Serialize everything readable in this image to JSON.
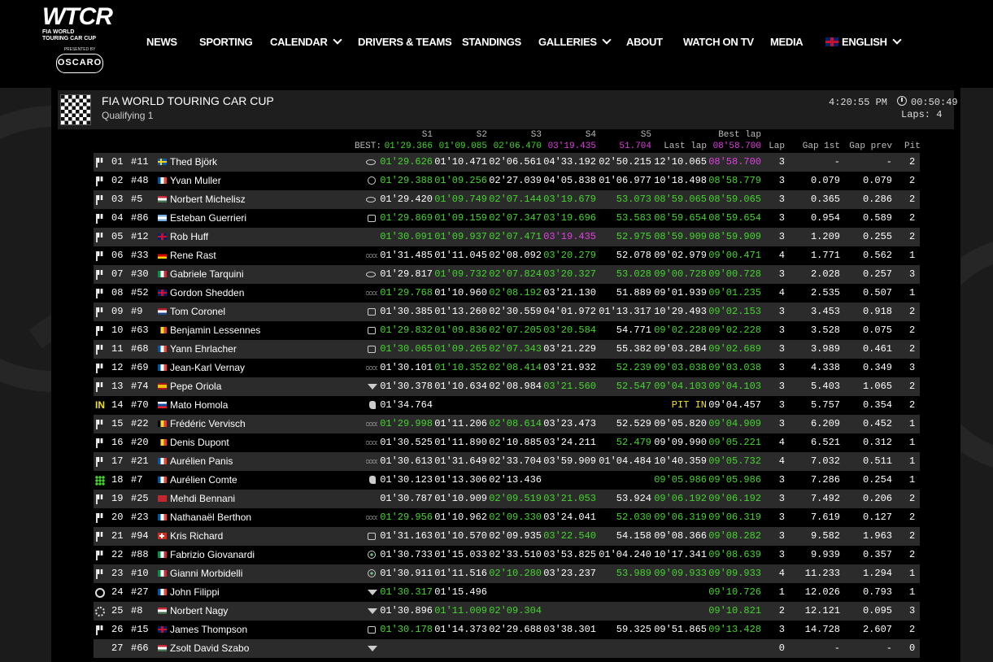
{
  "nav": {
    "logo": {
      "wordmark": "WTCR",
      "line1": "FIA WORLD",
      "line2": "TOURING CAR CUP",
      "presented": "PRESENTED BY",
      "sponsor": "OSCARO"
    },
    "items": [
      {
        "label": "NEWS",
        "dropdown": false
      },
      {
        "label": "SPORTING",
        "dropdown": false
      },
      {
        "label": "CALENDAR",
        "dropdown": true
      },
      {
        "label": "DRIVERS & TEAMS",
        "dropdown": false
      },
      {
        "label": "STANDINGS",
        "dropdown": false
      },
      {
        "label": "GALLERIES",
        "dropdown": true
      },
      {
        "label": "ABOUT",
        "dropdown": false
      },
      {
        "label": "WATCH ON TV",
        "dropdown": false
      },
      {
        "label": "MEDIA",
        "dropdown": false
      }
    ],
    "language": "ENGLISH"
  },
  "session": {
    "series": "FIA WORLD TOURING CAR CUP",
    "name": "Qualifying 1",
    "clock": "4:20:55 PM",
    "remaining": "00:50:49",
    "laps": "Laps: 4"
  },
  "columns": {
    "best_label": "BEST:",
    "s1": "S1",
    "s2": "S2",
    "s3": "S3",
    "s4": "S4",
    "s5": "S5",
    "last_lap": "Last lap",
    "best_lap": "Best lap",
    "lap": "Lap",
    "gap_1st": "Gap 1st",
    "gap_prev": "Gap prev",
    "pit": "Pit"
  },
  "best": {
    "s1": "01'29.366",
    "s2": "01'09.085",
    "s3": "02'06.470",
    "s4": "03'19.435",
    "s5": "51.704",
    "best_lap": "08'58.700"
  },
  "colors": {
    "green": "#44d62c",
    "purple": "#e040e0",
    "yellow": "#f0e020"
  },
  "rows": [
    {
      "status": "flag",
      "pos": "01",
      "num": "#11",
      "flag": "se",
      "driver": "Thed Björk",
      "brand": "hyundai",
      "s1": "01'29.626",
      "s1c": "g",
      "s2": "01'10.471",
      "s2c": "w",
      "s3": "02'06.561",
      "s3c": "w",
      "s4": "04'33.192",
      "s4c": "w",
      "s5": "02'50.215",
      "s5c": "w",
      "last": "12'10.065",
      "lastc": "w",
      "best": "08'58.700",
      "bestc": "p",
      "lap": "3",
      "gap1": "-",
      "gapp": "-",
      "pit": "2"
    },
    {
      "status": "flag",
      "pos": "02",
      "num": "#48",
      "flag": "fr",
      "driver": "Yvan Muller",
      "brand": "lynk",
      "s1": "01'29.388",
      "s1c": "g",
      "s2": "01'09.256",
      "s2c": "g",
      "s3": "02'27.039",
      "s3c": "w",
      "s4": "04'05.838",
      "s4c": "w",
      "s5": "01'06.977",
      "s5c": "w",
      "last": "10'18.498",
      "lastc": "w",
      "best": "08'58.779",
      "bestc": "g",
      "lap": "3",
      "gap1": "0.079",
      "gapp": "0.079",
      "pit": "2"
    },
    {
      "status": "flag",
      "pos": "03",
      "num": "#5",
      "flag": "hu",
      "driver": "Norbert Michelisz",
      "brand": "hyundai",
      "s1": "01'29.420",
      "s1c": "w",
      "s2": "01'09.749",
      "s2c": "g",
      "s3": "02'07.144",
      "s3c": "g",
      "s4": "03'19.679",
      "s4c": "g",
      "s5": "53.073",
      "s5c": "g",
      "last": "08'59.065",
      "lastc": "g",
      "best": "08'59.065",
      "bestc": "g",
      "lap": "3",
      "gap1": "0.365",
      "gapp": "0.286",
      "pit": "2"
    },
    {
      "status": "flag",
      "pos": "04",
      "num": "#86",
      "flag": "ar",
      "driver": "Esteban Guerrieri",
      "brand": "honda",
      "s1": "01'29.869",
      "s1c": "g",
      "s2": "01'09.159",
      "s2c": "g",
      "s3": "02'07.347",
      "s3c": "g",
      "s4": "03'19.696",
      "s4c": "g",
      "s5": "53.583",
      "s5c": "g",
      "last": "08'59.654",
      "lastc": "g",
      "best": "08'59.654",
      "bestc": "g",
      "lap": "3",
      "gap1": "0.954",
      "gapp": "0.589",
      "pit": "2"
    },
    {
      "status": "flag",
      "pos": "05",
      "num": "#12",
      "flag": "gb",
      "driver": "Rob Huff",
      "brand": "vw",
      "s1": "01'30.091",
      "s1c": "g",
      "s2": "01'09.937",
      "s2c": "g",
      "s3": "02'07.471",
      "s3c": "g",
      "s4": "03'19.435",
      "s4c": "p",
      "s5": "52.975",
      "s5c": "g",
      "last": "08'59.909",
      "lastc": "g",
      "best": "08'59.909",
      "bestc": "g",
      "lap": "3",
      "gap1": "1.209",
      "gapp": "0.255",
      "pit": "2"
    },
    {
      "status": "flag",
      "pos": "06",
      "num": "#33",
      "flag": "de",
      "driver": "Rene Rast",
      "brand": "audi",
      "s1": "01'31.485",
      "s1c": "w",
      "s2": "01'11.045",
      "s2c": "w",
      "s3": "02'08.092",
      "s3c": "w",
      "s4": "03'20.279",
      "s4c": "g",
      "s5": "52.078",
      "s5c": "w",
      "last": "09'02.979",
      "lastc": "w",
      "best": "09'00.471",
      "bestc": "g",
      "lap": "4",
      "gap1": "1.771",
      "gapp": "0.562",
      "pit": "1"
    },
    {
      "status": "flag",
      "pos": "07",
      "num": "#30",
      "flag": "it",
      "driver": "Gabriele Tarquini",
      "brand": "hyundai",
      "s1": "01'29.817",
      "s1c": "w",
      "s2": "01'09.732",
      "s2c": "g",
      "s3": "02'07.824",
      "s3c": "g",
      "s4": "03'20.327",
      "s4c": "g",
      "s5": "53.028",
      "s5c": "g",
      "last": "09'00.728",
      "lastc": "g",
      "best": "09'00.728",
      "bestc": "g",
      "lap": "3",
      "gap1": "2.028",
      "gapp": "0.257",
      "pit": "3"
    },
    {
      "status": "flag",
      "pos": "08",
      "num": "#52",
      "flag": "gb",
      "driver": "Gordon Shedden",
      "brand": "audi",
      "s1": "01'29.768",
      "s1c": "g",
      "s2": "01'10.960",
      "s2c": "w",
      "s3": "02'08.192",
      "s3c": "g",
      "s4": "03'21.130",
      "s4c": "w",
      "s5": "51.889",
      "s5c": "w",
      "last": "09'01.939",
      "lastc": "w",
      "best": "09'01.235",
      "bestc": "g",
      "lap": "4",
      "gap1": "2.535",
      "gapp": "0.507",
      "pit": "1"
    },
    {
      "status": "flag",
      "pos": "09",
      "num": "#9",
      "flag": "nl",
      "driver": "Tom Coronel",
      "brand": "honda",
      "s1": "01'30.385",
      "s1c": "w",
      "s2": "01'13.260",
      "s2c": "w",
      "s3": "02'30.559",
      "s3c": "w",
      "s4": "04'01.972",
      "s4c": "w",
      "s5": "01'13.317",
      "s5c": "w",
      "last": "10'29.493",
      "lastc": "w",
      "best": "09'02.153",
      "bestc": "g",
      "lap": "3",
      "gap1": "3.453",
      "gapp": "0.918",
      "pit": "2"
    },
    {
      "status": "flag",
      "pos": "10",
      "num": "#63",
      "flag": "be",
      "driver": "Benjamin Lessennes",
      "brand": "honda",
      "s1": "01'29.832",
      "s1c": "g",
      "s2": "01'09.836",
      "s2c": "g",
      "s3": "02'07.205",
      "s3c": "g",
      "s4": "03'20.584",
      "s4c": "g",
      "s5": "54.771",
      "s5c": "w",
      "last": "09'02.228",
      "lastc": "g",
      "best": "09'02.228",
      "bestc": "g",
      "lap": "3",
      "gap1": "3.528",
      "gapp": "0.075",
      "pit": "2"
    },
    {
      "status": "flag",
      "pos": "11",
      "num": "#68",
      "flag": "fr",
      "driver": "Yann Ehrlacher",
      "brand": "honda",
      "s1": "01'30.065",
      "s1c": "g",
      "s2": "01'09.265",
      "s2c": "g",
      "s3": "02'07.343",
      "s3c": "g",
      "s4": "03'21.229",
      "s4c": "w",
      "s5": "55.382",
      "s5c": "w",
      "last": "09'03.284",
      "lastc": "w",
      "best": "09'02.689",
      "bestc": "g",
      "lap": "3",
      "gap1": "3.989",
      "gapp": "0.461",
      "pit": "2"
    },
    {
      "status": "flag",
      "pos": "12",
      "num": "#69",
      "flag": "fr",
      "driver": "Jean-Karl Vernay",
      "brand": "audi",
      "s1": "01'30.101",
      "s1c": "w",
      "s2": "01'10.352",
      "s2c": "g",
      "s3": "02'08.414",
      "s3c": "g",
      "s4": "03'21.932",
      "s4c": "w",
      "s5": "52.239",
      "s5c": "g",
      "last": "09'03.038",
      "lastc": "g",
      "best": "09'03.038",
      "bestc": "g",
      "lap": "3",
      "gap1": "4.338",
      "gapp": "0.349",
      "pit": "3"
    },
    {
      "status": "flag",
      "pos": "13",
      "num": "#74",
      "flag": "es",
      "driver": "Pepe Oriola",
      "brand": "cupra",
      "s1": "01'30.378",
      "s1c": "w",
      "s2": "01'10.634",
      "s2c": "w",
      "s3": "02'08.984",
      "s3c": "w",
      "s4": "03'21.560",
      "s4c": "g",
      "s5": "52.547",
      "s5c": "g",
      "last": "09'04.103",
      "lastc": "g",
      "best": "09'04.103",
      "bestc": "g",
      "lap": "3",
      "gap1": "5.403",
      "gapp": "1.065",
      "pit": "2"
    },
    {
      "status": "in",
      "pos": "14",
      "num": "#70",
      "flag": "sk",
      "driver": "Mato Homola",
      "brand": "peugeot",
      "s1": "01'34.764",
      "s1c": "w",
      "s2": "",
      "s2c": "w",
      "s3": "",
      "s3c": "w",
      "s4": "",
      "s4c": "w",
      "s5": "",
      "s5c": "w",
      "last": "PIT IN",
      "lastc": "y",
      "best": "09'04.457",
      "bestc": "w",
      "lap": "3",
      "gap1": "5.757",
      "gapp": "0.354",
      "pit": "2"
    },
    {
      "status": "flag",
      "pos": "15",
      "num": "#22",
      "flag": "be",
      "driver": "Frédéric Vervisch",
      "brand": "audi",
      "s1": "01'29.998",
      "s1c": "g",
      "s2": "01'11.206",
      "s2c": "w",
      "s3": "02'08.614",
      "s3c": "g",
      "s4": "03'23.473",
      "s4c": "w",
      "s5": "52.529",
      "s5c": "w",
      "last": "09'05.820",
      "lastc": "w",
      "best": "09'04.909",
      "bestc": "g",
      "lap": "3",
      "gap1": "6.209",
      "gapp": "0.452",
      "pit": "1"
    },
    {
      "status": "flag",
      "pos": "16",
      "num": "#20",
      "flag": "be",
      "driver": "Denis Dupont",
      "brand": "audi",
      "s1": "01'30.525",
      "s1c": "w",
      "s2": "01'11.890",
      "s2c": "w",
      "s3": "02'10.885",
      "s3c": "w",
      "s4": "03'24.211",
      "s4c": "w",
      "s5": "52.479",
      "s5c": "g",
      "last": "09'09.990",
      "lastc": "w",
      "best": "09'05.221",
      "bestc": "g",
      "lap": "4",
      "gap1": "6.521",
      "gapp": "0.312",
      "pit": "1"
    },
    {
      "status": "flag",
      "pos": "17",
      "num": "#21",
      "flag": "fr",
      "driver": "Aurélien Panis",
      "brand": "audi",
      "s1": "01'30.613",
      "s1c": "w",
      "s2": "01'31.649",
      "s2c": "w",
      "s3": "02'33.704",
      "s3c": "w",
      "s4": "03'59.909",
      "s4c": "w",
      "s5": "01'04.484",
      "s5c": "w",
      "last": "10'40.359",
      "lastc": "w",
      "best": "09'05.732",
      "bestc": "g",
      "lap": "4",
      "gap1": "7.032",
      "gapp": "0.511",
      "pit": "1"
    },
    {
      "status": "dots",
      "pos": "18",
      "num": "#7",
      "flag": "fr",
      "driver": "Aurélien Comte",
      "brand": "peugeot",
      "s1": "01'30.123",
      "s1c": "w",
      "s2": "01'13.306",
      "s2c": "w",
      "s3": "02'13.436",
      "s3c": "w",
      "s4": "",
      "s4c": "w",
      "s5": "",
      "s5c": "w",
      "last": "09'05.986",
      "lastc": "g",
      "best": "09'05.986",
      "bestc": "g",
      "lap": "3",
      "gap1": "7.286",
      "gapp": "0.254",
      "pit": "1"
    },
    {
      "status": "flag",
      "pos": "19",
      "num": "#25",
      "flag": "ma",
      "driver": "Mehdi Bennani",
      "brand": "vw",
      "s1": "01'30.787",
      "s1c": "w",
      "s2": "01'10.909",
      "s2c": "w",
      "s3": "02'09.519",
      "s3c": "g",
      "s4": "03'21.053",
      "s4c": "g",
      "s5": "53.924",
      "s5c": "w",
      "last": "09'06.192",
      "lastc": "g",
      "best": "09'06.192",
      "bestc": "g",
      "lap": "3",
      "gap1": "7.492",
      "gapp": "0.206",
      "pit": "2"
    },
    {
      "status": "flag",
      "pos": "20",
      "num": "#23",
      "flag": "fr",
      "driver": "Nathanaël Berthon",
      "brand": "audi",
      "s1": "01'29.956",
      "s1c": "g",
      "s2": "01'10.962",
      "s2c": "w",
      "s3": "02'09.330",
      "s3c": "g",
      "s4": "03'24.041",
      "s4c": "w",
      "s5": "52.030",
      "s5c": "g",
      "last": "09'06.319",
      "lastc": "g",
      "best": "09'06.319",
      "bestc": "g",
      "lap": "3",
      "gap1": "7.619",
      "gapp": "0.127",
      "pit": "2"
    },
    {
      "status": "flag",
      "pos": "21",
      "num": "#94",
      "flag": "ch",
      "driver": "Kris Richard",
      "brand": "honda",
      "s1": "01'31.163",
      "s1c": "w",
      "s2": "01'10.570",
      "s2c": "w",
      "s3": "02'09.935",
      "s3c": "w",
      "s4": "03'22.540",
      "s4c": "g",
      "s5": "54.158",
      "s5c": "w",
      "last": "09'08.366",
      "lastc": "w",
      "best": "09'08.282",
      "bestc": "g",
      "lap": "3",
      "gap1": "9.582",
      "gapp": "1.963",
      "pit": "2"
    },
    {
      "status": "flag",
      "pos": "22",
      "num": "#88",
      "flag": "it",
      "driver": "Fabrizio Giovanardi",
      "brand": "alfa",
      "s1": "01'30.733",
      "s1c": "w",
      "s2": "01'15.033",
      "s2c": "w",
      "s3": "02'33.510",
      "s3c": "w",
      "s4": "03'53.825",
      "s4c": "w",
      "s5": "01'04.240",
      "s5c": "w",
      "last": "10'17.341",
      "lastc": "w",
      "best": "09'08.639",
      "bestc": "g",
      "lap": "3",
      "gap1": "9.939",
      "gapp": "0.357",
      "pit": "2"
    },
    {
      "status": "flag",
      "pos": "23",
      "num": "#10",
      "flag": "it",
      "driver": "Gianni Morbidelli",
      "brand": "alfa",
      "s1": "01'30.911",
      "s1c": "w",
      "s2": "01'11.516",
      "s2c": "w",
      "s3": "02'10.280",
      "s3c": "g",
      "s4": "03'23.237",
      "s4c": "w",
      "s5": "53.989",
      "s5c": "g",
      "last": "09'09.933",
      "lastc": "g",
      "best": "09'09.933",
      "bestc": "g",
      "lap": "4",
      "gap1": "11.233",
      "gapp": "1.294",
      "pit": "1"
    },
    {
      "status": "ring",
      "pos": "24",
      "num": "#27",
      "flag": "fr",
      "driver": "John Filippi",
      "brand": "cupra",
      "s1": "01'30.317",
      "s1c": "g",
      "s2": "01'15.496",
      "s2c": "w",
      "s3": "",
      "s3c": "w",
      "s4": "",
      "s4c": "w",
      "s5": "",
      "s5c": "w",
      "last": "",
      "lastc": "w",
      "best": "09'10.726",
      "bestc": "g",
      "lap": "1",
      "gap1": "12.026",
      "gapp": "0.793",
      "pit": "1"
    },
    {
      "status": "dashring",
      "pos": "25",
      "num": "#8",
      "flag": "hu",
      "driver": "Norbert Nagy",
      "brand": "cupra",
      "s1": "01'30.896",
      "s1c": "w",
      "s2": "01'11.009",
      "s2c": "g",
      "s3": "02'09.304",
      "s3c": "g",
      "s4": "",
      "s4c": "w",
      "s5": "",
      "s5c": "w",
      "last": "",
      "lastc": "w",
      "best": "09'10.821",
      "bestc": "g",
      "lap": "2",
      "gap1": "12.121",
      "gapp": "0.095",
      "pit": "3"
    },
    {
      "status": "flag",
      "pos": "26",
      "num": "#15",
      "flag": "gb",
      "driver": "James Thompson",
      "brand": "honda",
      "s1": "01'30.178",
      "s1c": "g",
      "s2": "01'14.373",
      "s2c": "w",
      "s3": "02'29.688",
      "s3c": "w",
      "s4": "03'38.301",
      "s4c": "w",
      "s5": "59.325",
      "s5c": "w",
      "last": "09'51.865",
      "lastc": "w",
      "best": "09'13.428",
      "bestc": "g",
      "lap": "3",
      "gap1": "14.728",
      "gapp": "2.607",
      "pit": "2"
    },
    {
      "status": "none",
      "pos": "27",
      "num": "#66",
      "flag": "hu",
      "driver": "Zsolt David Szabo",
      "brand": "cupra",
      "s1": "",
      "s1c": "w",
      "s2": "",
      "s2c": "w",
      "s3": "",
      "s3c": "w",
      "s4": "",
      "s4c": "w",
      "s5": "",
      "s5c": "w",
      "last": "",
      "lastc": "w",
      "best": "",
      "bestc": "w",
      "lap": "0",
      "gap1": "-",
      "gapp": "-",
      "pit": "0"
    }
  ]
}
